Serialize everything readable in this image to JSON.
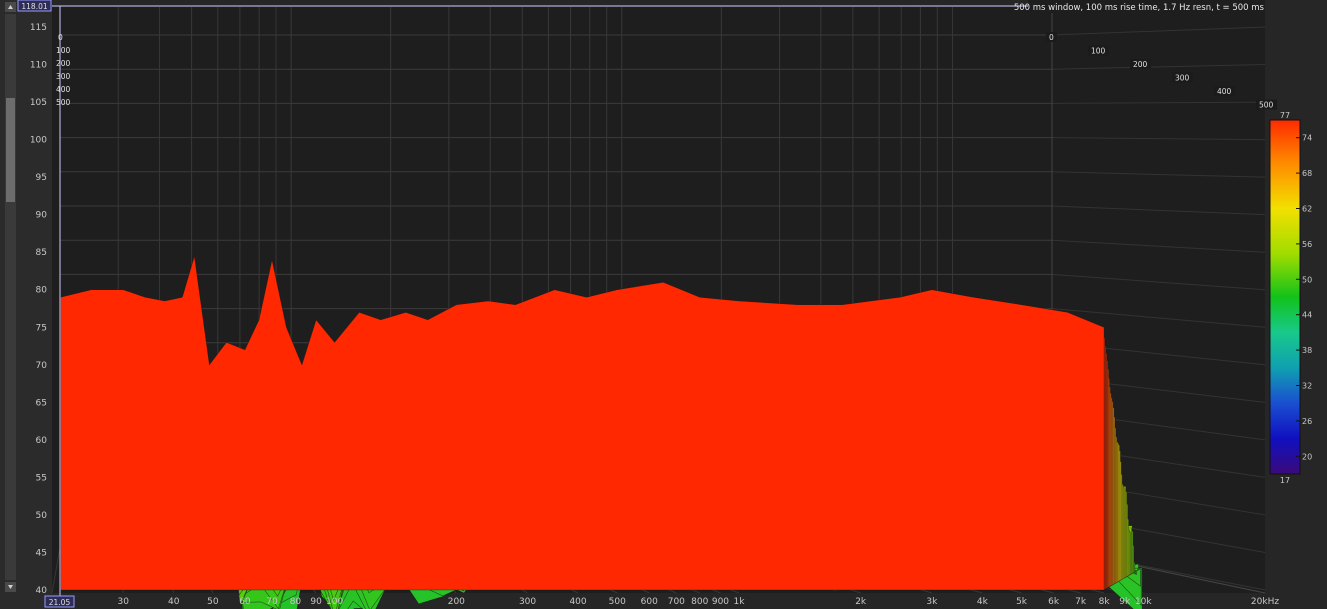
{
  "chart_data": {
    "type": "waterfall",
    "title": "500 ms window, 100 ms rise time, 1.7 Hz resn, t = 500 ms",
    "cursor": {
      "y_readout": "118.01",
      "x_readout": "21.05"
    },
    "y_axis": {
      "ticks": [
        "40",
        "45",
        "50",
        "55",
        "60",
        "65",
        "70",
        "75",
        "80",
        "85",
        "90",
        "95",
        "100",
        "105",
        "110",
        "115"
      ],
      "range": [
        40,
        118
      ]
    },
    "x_axis": {
      "ticks": [
        "30",
        "40",
        "50",
        "60",
        "70",
        "80",
        "90",
        "100",
        "200",
        "300",
        "400",
        "500",
        "600",
        "700",
        "800",
        "900",
        "1k",
        "2k",
        "3k",
        "4k",
        "5k",
        "6k",
        "7k",
        "8k",
        "9k",
        "10k",
        "20kHz"
      ],
      "range_hz": [
        20,
        20000
      ],
      "scale": "log"
    },
    "time_axis": {
      "left_labels": [
        "0",
        "100",
        "200",
        "300",
        "400",
        "500"
      ],
      "right_labels": [
        "0",
        "100",
        "200",
        "300",
        "400",
        "500"
      ],
      "unit": "ms"
    },
    "colorbar": {
      "top": "77",
      "bottom": "17",
      "ticks": [
        "74",
        "68",
        "62",
        "56",
        "50",
        "44",
        "38",
        "32",
        "26",
        "20"
      ],
      "range": [
        17,
        77
      ]
    },
    "front_slice": [
      {
        "f": 21,
        "db": 79
      },
      {
        "f": 25,
        "db": 80
      },
      {
        "f": 30,
        "db": 80
      },
      {
        "f": 34,
        "db": 79
      },
      {
        "f": 38,
        "db": 78.5
      },
      {
        "f": 42,
        "db": 79
      },
      {
        "f": 45,
        "db": 84.5
      },
      {
        "f": 49,
        "db": 70
      },
      {
        "f": 54,
        "db": 73
      },
      {
        "f": 60,
        "db": 72
      },
      {
        "f": 65,
        "db": 76
      },
      {
        "f": 70,
        "db": 84
      },
      {
        "f": 76,
        "db": 75
      },
      {
        "f": 83,
        "db": 70
      },
      {
        "f": 90,
        "db": 76
      },
      {
        "f": 100,
        "db": 73
      },
      {
        "f": 115,
        "db": 77
      },
      {
        "f": 130,
        "db": 76
      },
      {
        "f": 150,
        "db": 77
      },
      {
        "f": 170,
        "db": 76
      },
      {
        "f": 200,
        "db": 78
      },
      {
        "f": 240,
        "db": 78.5
      },
      {
        "f": 280,
        "db": 78
      },
      {
        "f": 350,
        "db": 80
      },
      {
        "f": 420,
        "db": 79
      },
      {
        "f": 500,
        "db": 80
      },
      {
        "f": 650,
        "db": 81
      },
      {
        "f": 800,
        "db": 79
      },
      {
        "f": 1000,
        "db": 78.5
      },
      {
        "f": 1400,
        "db": 78
      },
      {
        "f": 1800,
        "db": 78
      },
      {
        "f": 2500,
        "db": 79
      },
      {
        "f": 3000,
        "db": 80
      },
      {
        "f": 3800,
        "db": 79
      },
      {
        "f": 5000,
        "db": 78
      },
      {
        "f": 6500,
        "db": 77
      },
      {
        "f": 8000,
        "db": 75
      }
    ]
  }
}
